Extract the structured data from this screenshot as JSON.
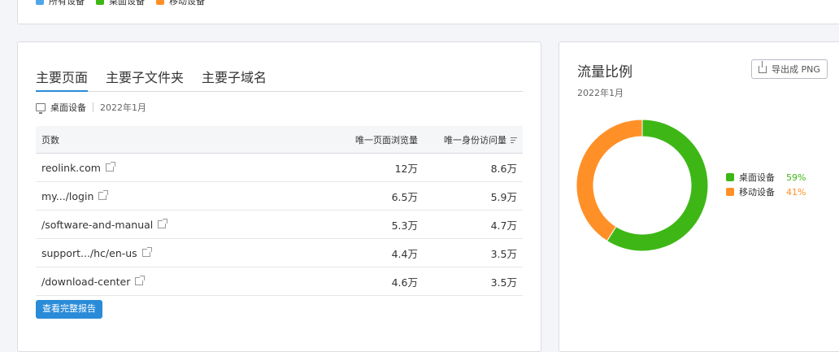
{
  "top_legend": [
    {
      "label": "所有设备",
      "color": "#4da6e8"
    },
    {
      "label": "桌面设备",
      "color": "#3eb716"
    },
    {
      "label": "移动设备",
      "color": "#ff9027"
    }
  ],
  "left": {
    "tabs": [
      "主要页面",
      "主要子文件夹",
      "主要子域名"
    ],
    "active_tab": 0,
    "device": "桌面设备",
    "date": "2022年1月",
    "table": {
      "headers": [
        "页数",
        "唯一页面浏览量",
        "唯一身份访问量"
      ],
      "rows": [
        [
          "reolink.com",
          "12万",
          "8.6万"
        ],
        [
          "my.../login",
          "6.5万",
          "5.9万"
        ],
        [
          "/software-and-manual",
          "5.3万",
          "4.7万"
        ],
        [
          "support.../hc/en-us",
          "4.4万",
          "3.5万"
        ],
        [
          "/download-center",
          "4.6万",
          "3.5万"
        ]
      ]
    },
    "button": "查看完整报告"
  },
  "right": {
    "title": "流量比例",
    "date": "2022年1月",
    "export": "导出成 PNG",
    "chart_data": {
      "type": "pie",
      "categories": [
        "桌面设备",
        "移动设备"
      ],
      "values": [
        59,
        41
      ],
      "value_labels": [
        "59%",
        "41%"
      ],
      "colors": [
        "#3eb716",
        "#ff9027"
      ],
      "legend_position": "right"
    }
  }
}
